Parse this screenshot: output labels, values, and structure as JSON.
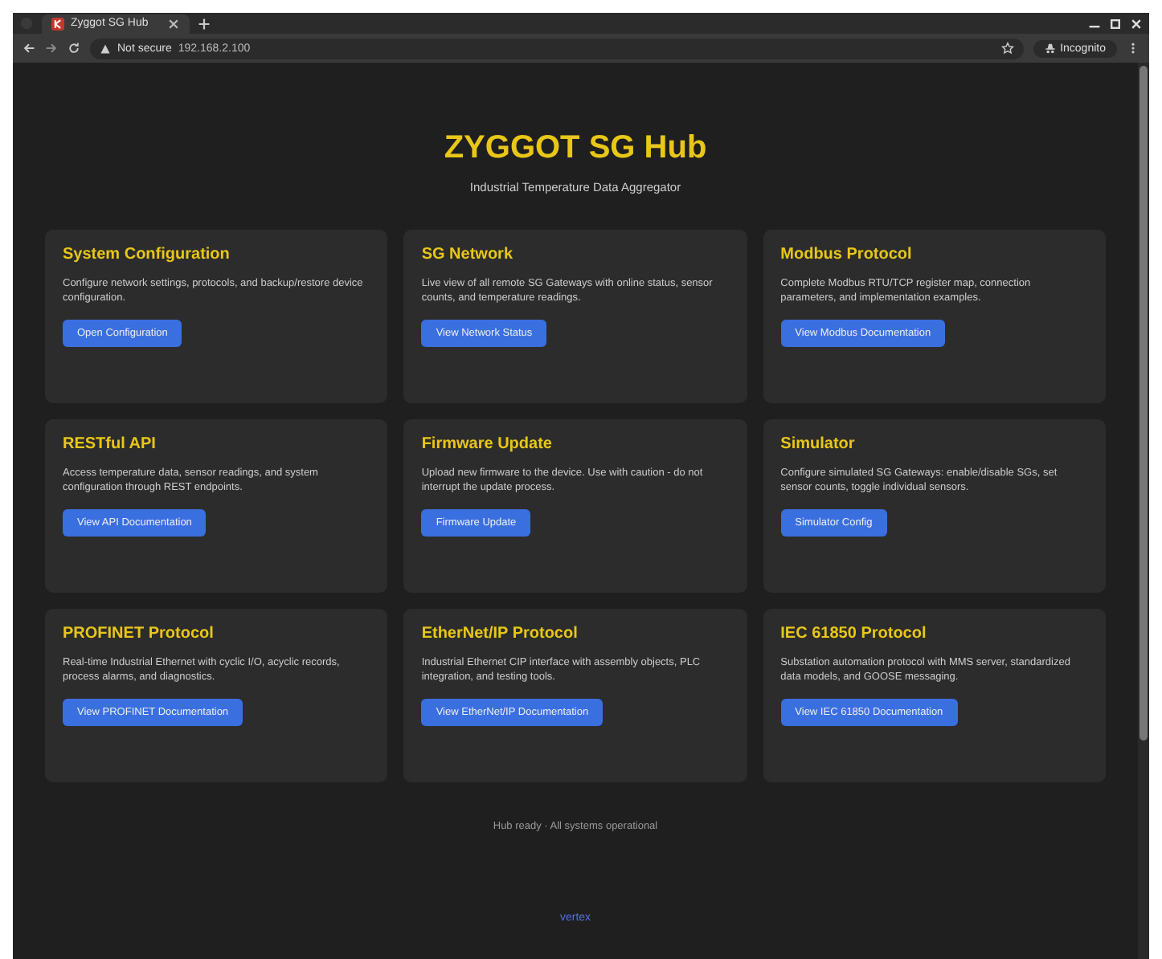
{
  "browser": {
    "tab_title": "Zyggot SG Hub",
    "security": "Not secure",
    "url": "192.168.2.100",
    "profile": "Incognito"
  },
  "header": {
    "title": "ZYGGOT SG Hub",
    "subtitle": "Industrial Temperature Data Aggregator"
  },
  "cards": [
    {
      "title": "System Configuration",
      "description": "Configure network settings, protocols, and backup/restore device configuration.",
      "button": "Open Configuration"
    },
    {
      "title": "SG Network",
      "description": "Live view of all remote SG Gateways with online status, sensor counts, and temperature readings.",
      "button": "View Network Status"
    },
    {
      "title": "Modbus Protocol",
      "description": "Complete Modbus RTU/TCP register map, connection parameters, and implementation examples.",
      "button": "View Modbus Documentation"
    },
    {
      "title": "RESTful API",
      "description": "Access temperature data, sensor readings, and system configuration through REST endpoints.",
      "button": "View API Documentation"
    },
    {
      "title": "Firmware Update",
      "description": "Upload new firmware to the device. Use with caution - do not interrupt the update process.",
      "button": "Firmware Update"
    },
    {
      "title": "Simulator",
      "description": "Configure simulated SG Gateways: enable/disable SGs, set sensor counts, toggle individual sensors.",
      "button": "Simulator Config"
    },
    {
      "title": "PROFINET Protocol",
      "description": "Real-time Industrial Ethernet with cyclic I/O, acyclic records, process alarms, and diagnostics.",
      "button": "View PROFINET Documentation"
    },
    {
      "title": "EtherNet/IP Protocol",
      "description": "Industrial Ethernet CIP interface with assembly objects, PLC integration, and testing tools.",
      "button": "View EtherNet/IP Documentation"
    },
    {
      "title": "IEC 61850 Protocol",
      "description": "Substation automation protocol with MMS server, standardized data models, and GOOSE messaging.",
      "button": "View IEC 61850 Documentation"
    }
  ],
  "status": "Hub ready · All systems operational",
  "footer_logo": "vertex"
}
